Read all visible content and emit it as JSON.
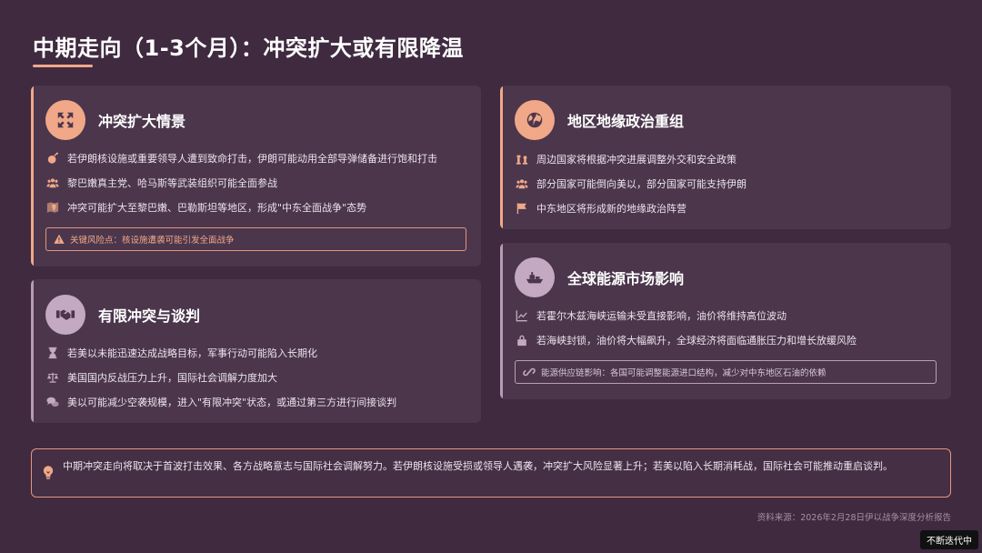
{
  "header": {
    "title": "中期走向（1-3个月）：冲突扩大或有限降温"
  },
  "cards": [
    {
      "title": "冲突扩大情景",
      "icon": "expand-arrows-icon",
      "items": [
        {
          "icon": "bomb-icon",
          "text": "若伊朗核设施或重要领导人遭到致命打击，伊朗可能动用全部导弹储备进行饱和打击"
        },
        {
          "icon": "users-icon",
          "text": "黎巴嫩真主党、哈马斯等武装组织可能全面参战"
        },
        {
          "icon": "map-icon",
          "text": "冲突可能扩大至黎巴嫩、巴勒斯坦等地区，形成\"中东全面战争\"态势"
        }
      ],
      "note": {
        "icon": "warning-icon",
        "text": "关键风险点：核设施遭袭可能引发全面战争"
      }
    },
    {
      "title": "有限冲突与谈判",
      "icon": "handshake-icon",
      "items": [
        {
          "icon": "hourglass-icon",
          "text": "若美以未能迅速达成战略目标，军事行动可能陷入长期化"
        },
        {
          "icon": "scale-icon",
          "text": "美国国内反战压力上升，国际社会调解力度加大"
        },
        {
          "icon": "chat-icon",
          "text": "美以可能减少空袭规模，进入\"有限冲突\"状态，或通过第三方进行间接谈判"
        }
      ]
    },
    {
      "title": "地区地缘政治重组",
      "icon": "globe-icon",
      "items": [
        {
          "icon": "chess-icon",
          "text": "周边国家将根据冲突进展调整外交和安全政策"
        },
        {
          "icon": "users-icon",
          "text": "部分国家可能倒向美以，部分国家可能支持伊朗"
        },
        {
          "icon": "flag-icon",
          "text": "中东地区将形成新的地缘政治阵营"
        }
      ]
    },
    {
      "title": "全球能源市场影响",
      "icon": "oil-tanker-icon",
      "items": [
        {
          "icon": "chart-line-icon",
          "text": "若霍尔木兹海峡运输未受直接影响，油价将维持高位波动"
        },
        {
          "icon": "lock-icon",
          "text": "若海峡封锁，油价将大幅飙升，全球经济将面临通胀压力和增长放缓风险"
        }
      ],
      "note": {
        "icon": "link-icon",
        "text": "能源供应链影响：各国可能调整能源进口结构，减少对中东地区石油的依赖"
      }
    }
  ],
  "summary": {
    "icon": "lightbulb-icon",
    "text": "中期冲突走向将取决于首波打击效果、各方战略意志与国际社会调解努力。若伊朗核设施受损或领导人遇袭，冲突扩大风险显著上升；若美以陷入长期消耗战，国际社会可能推动重启谈判。"
  },
  "footer": {
    "source": "资料来源：2026年2月28日伊以战争深度分析报告",
    "badge": "不断迭代中"
  },
  "colors": {
    "background": "#3f2a40",
    "card": "#4b364c",
    "accent_peach": "#f0a888",
    "accent_lavender": "#c4a9c3"
  }
}
